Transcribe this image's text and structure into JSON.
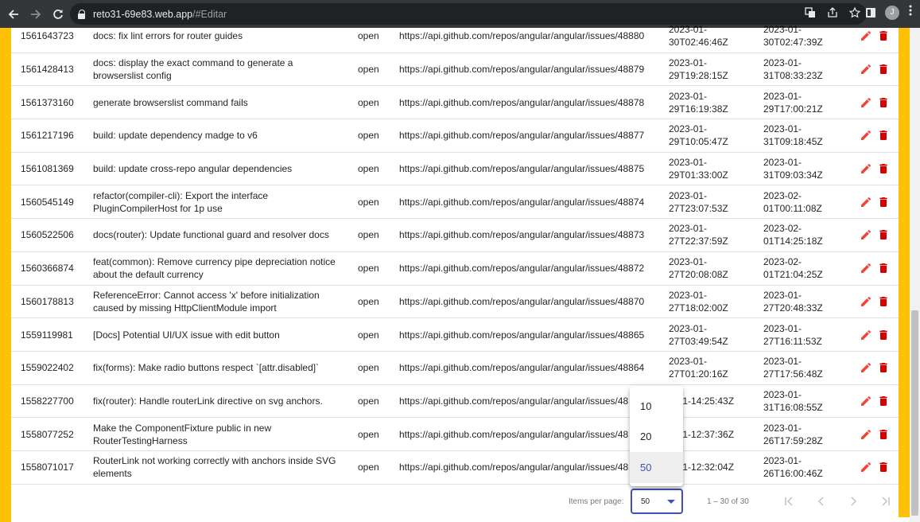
{
  "browser": {
    "url_host": "reto31-69e83.web.app",
    "url_path": "/#Editar",
    "avatar_letter": "J"
  },
  "icons": {
    "back": "arrow-left-icon",
    "forward": "arrow-right-icon",
    "reload": "reload-icon",
    "lock": "lock-icon",
    "translate": "translate-icon",
    "share": "share-icon",
    "star": "star-icon",
    "side_panel": "side-panel-icon",
    "menu": "kebab-menu-icon",
    "edit": "pencil-icon",
    "delete": "trash-icon"
  },
  "colors": {
    "accent": "#3f51b5",
    "edit_icon": "#f44336",
    "delete_icon": "#d50000",
    "side_bars": "#ffc107"
  },
  "issues": [
    {
      "id": "1561643723",
      "title": "docs: fix lint errors for router guides",
      "state": "open",
      "url": "https://api.github.com/repos/angular/angular/issues/48880",
      "created": "2023-01-30T02:46:46Z",
      "updated": "2023-01-30T02:47:39Z"
    },
    {
      "id": "1561428413",
      "title": "docs: display the exact command to generate a browserslist config",
      "state": "open",
      "url": "https://api.github.com/repos/angular/angular/issues/48879",
      "created": "2023-01-29T19:28:15Z",
      "updated": "2023-01-31T08:33:23Z"
    },
    {
      "id": "1561373160",
      "title": "generate browserslist command fails",
      "state": "open",
      "url": "https://api.github.com/repos/angular/angular/issues/48878",
      "created": "2023-01-29T16:19:38Z",
      "updated": "2023-01-29T17:00:21Z"
    },
    {
      "id": "1561217196",
      "title": "build: update dependency madge to v6",
      "state": "open",
      "url": "https://api.github.com/repos/angular/angular/issues/48877",
      "created": "2023-01-29T10:05:47Z",
      "updated": "2023-01-31T09:18:45Z"
    },
    {
      "id": "1561081369",
      "title": "build: update cross-repo angular dependencies",
      "state": "open",
      "url": "https://api.github.com/repos/angular/angular/issues/48875",
      "created": "2023-01-29T01:33:00Z",
      "updated": "2023-01-31T09:03:34Z"
    },
    {
      "id": "1560545149",
      "title": "refactor(compiler-cli): Export the interface PluginCompilerHost for 1p use",
      "state": "open",
      "url": "https://api.github.com/repos/angular/angular/issues/48874",
      "created": "2023-01-27T23:07:53Z",
      "updated": "2023-02-01T00:11:08Z"
    },
    {
      "id": "1560522506",
      "title": "docs(router): Update functional guard and resolver docs",
      "state": "open",
      "url": "https://api.github.com/repos/angular/angular/issues/48873",
      "created": "2023-01-27T22:37:59Z",
      "updated": "2023-02-01T14:25:18Z"
    },
    {
      "id": "1560366874",
      "title": "feat(common): Remove currency pipe depreciation notice about the default currency",
      "state": "open",
      "url": "https://api.github.com/repos/angular/angular/issues/48872",
      "created": "2023-01-27T20:08:08Z",
      "updated": "2023-02-01T21:04:25Z"
    },
    {
      "id": "1560178813",
      "title": "ReferenceError: Cannot access 'x' before initialization caused by missing HttpClientModule import",
      "state": "open",
      "url": "https://api.github.com/repos/angular/angular/issues/48870",
      "created": "2023-01-27T18:02:00Z",
      "updated": "2023-01-27T20:48:33Z"
    },
    {
      "id": "1559119981",
      "title": "[Docs] Potential UI/UX issue with edit button",
      "state": "open",
      "url": "https://api.github.com/repos/angular/angular/issues/48865",
      "created": "2023-01-27T03:49:54Z",
      "updated": "2023-01-27T16:11:53Z"
    },
    {
      "id": "1559022402",
      "title": "fix(forms): Make radio buttons respect `[attr.disabled]`",
      "state": "open",
      "url": "https://api.github.com/repos/angular/angular/issues/48864",
      "created": "2023-01-27T01:20:16Z",
      "updated": "2023-01-27T17:56:48Z"
    },
    {
      "id": "1558227700",
      "title": "fix(router): Handle routerLink directive on svg anchors.",
      "state": "open",
      "url": "https://api.github.com/repos/angular/angular/issues/48",
      "created": "3-01-14:25:43Z",
      "updated": "2023-01-31T16:08:55Z"
    },
    {
      "id": "1558077252",
      "title": "Make the ComponentFixture public in new RouterTestingHarness",
      "state": "open",
      "url": "https://api.github.com/repos/angular/angular/issues/48",
      "created": "3-01-12:37:36Z",
      "updated": "2023-01-26T17:59:28Z"
    },
    {
      "id": "1558071017",
      "title": "RouterLink not working correctly with anchors inside SVG elements",
      "state": "open",
      "url": "https://api.github.com/repos/angular/angular/issues/48",
      "created": "3-01-12:32:04Z",
      "updated": "2023-01-26T16:00:46Z"
    }
  ],
  "paginator": {
    "items_per_page_label": "Items per page:",
    "selected_page_size": "50",
    "range_label": "1 – 30 of 30",
    "page_size_options": [
      {
        "value": "10",
        "selected": false
      },
      {
        "value": "20",
        "selected": false
      },
      {
        "value": "50",
        "selected": true
      }
    ]
  }
}
